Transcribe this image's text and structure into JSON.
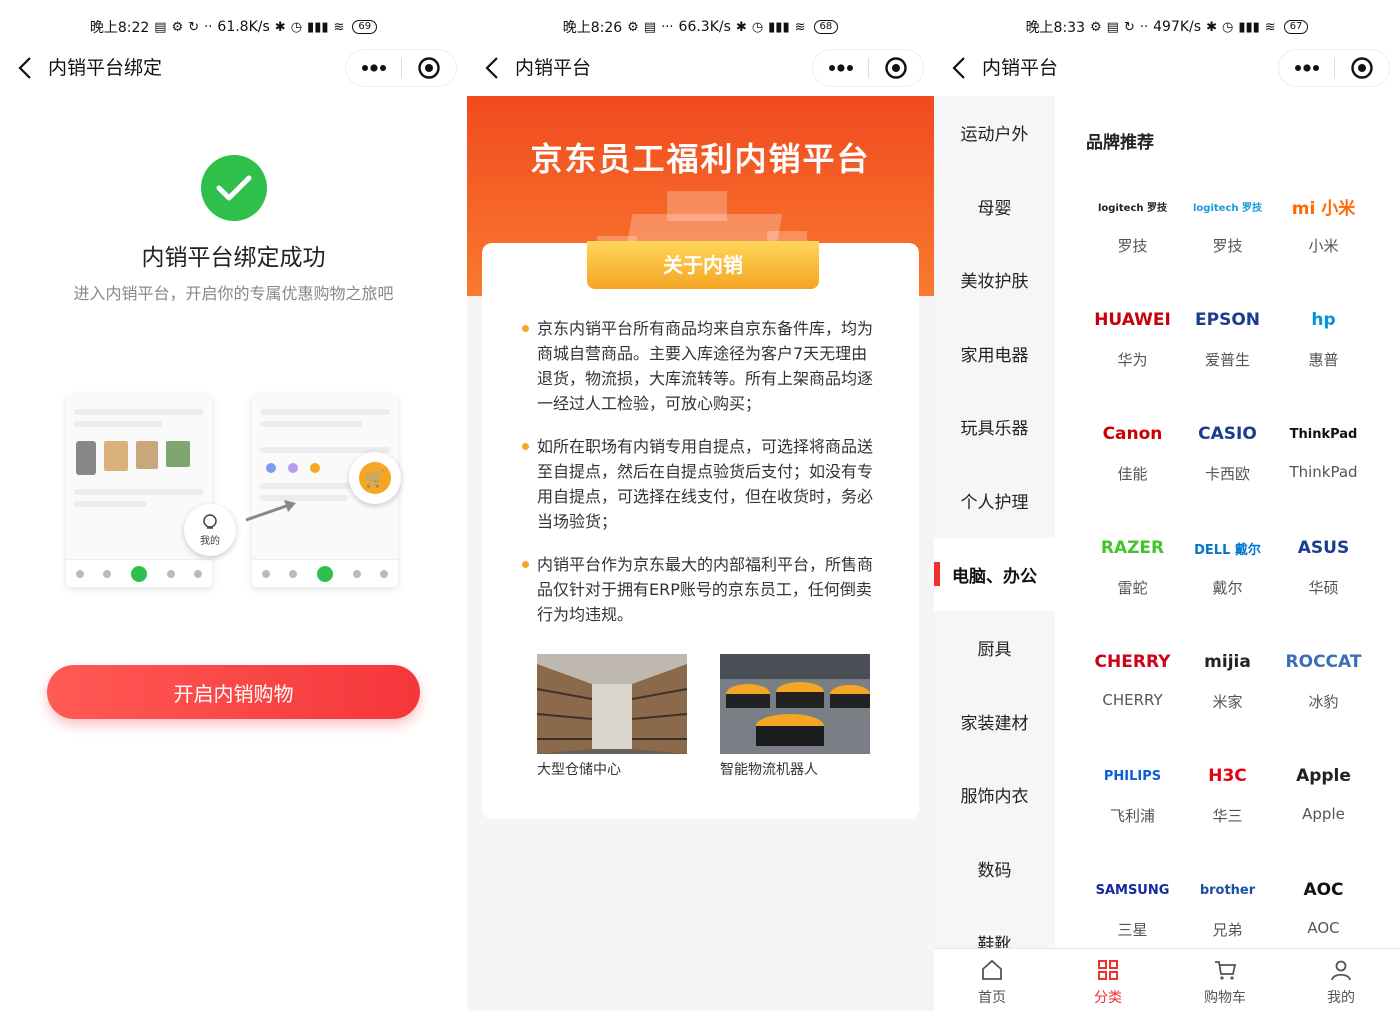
{
  "panel1": {
    "status": {
      "time": "晚上8:22",
      "speed": "61.8K/s",
      "battery": "69"
    },
    "nav_title": "内销平台绑定",
    "success_title": "内销平台绑定成功",
    "success_sub": "进入内销平台，开启你的专属优惠购物之旅吧",
    "bubble_label": "我的",
    "start_button": "开启内销购物",
    "colors": {
      "accent": "#f5363a",
      "success": "#2ec04a"
    }
  },
  "panel2": {
    "status": {
      "time": "晚上8:26",
      "speed": "66.3K/s",
      "battery": "68"
    },
    "nav_title": "内销平台",
    "banner_title": "京东员工福利内销平台",
    "card_tab": "关于内销",
    "paragraphs": [
      "京东内销平台所有商品均来自京东备件库，均为商城自营商品。主要入库途径为客户7天无理由退货，物流损，大库流转等。所有上架商品均逐一经过人工检验，可放心购买；",
      "如所在职场有内销专用自提点，可选择将商品送至自提点，然后在自提点验货后支付；如没有专用自提点，可选择在线支付，但在收货时，务必当场验货；",
      "内销平台作为京东最大的内部福利平台，所售商品仅针对于拥有ERP账号的京东员工，任何倒卖行为均违规。"
    ],
    "photos": [
      {
        "caption": "大型仓储中心"
      },
      {
        "caption": "智能物流机器人"
      }
    ],
    "colors": {
      "banner": "#f14a1f",
      "tab": "#f5a623"
    }
  },
  "panel3": {
    "status": {
      "time": "晚上8:33",
      "speed": "497K/s",
      "battery": "67"
    },
    "nav_title": "内销平台",
    "categories": [
      "运动户外",
      "母婴",
      "美妆护肤",
      "家用电器",
      "玩具乐器",
      "个人护理",
      "电脑、办公",
      "厨具",
      "家装建材",
      "服饰内衣",
      "数码",
      "鞋靴"
    ],
    "active_category": "电脑、办公",
    "brand_heading": "品牌推荐",
    "brands": [
      {
        "logo": "logitech 罗技",
        "name": "罗技",
        "color": "#222"
      },
      {
        "logo": "logitech 罗技",
        "name": "罗技",
        "color": "#1a9ad6"
      },
      {
        "logo": "mi 小米",
        "name": "小米",
        "color": "#ff6900"
      },
      {
        "logo": "HUAWEI",
        "name": "华为",
        "color": "#c7000b"
      },
      {
        "logo": "EPSON",
        "name": "爱普生",
        "color": "#1d3c8f"
      },
      {
        "logo": "hp",
        "name": "惠普",
        "color": "#0096d6"
      },
      {
        "logo": "Canon",
        "name": "佳能",
        "color": "#cc0000"
      },
      {
        "logo": "CASIO",
        "name": "卡西欧",
        "color": "#1d3c8f"
      },
      {
        "logo": "ThinkPad",
        "name": "ThinkPad",
        "color": "#111"
      },
      {
        "logo": "RAZER",
        "name": "雷蛇",
        "color": "#44c42c"
      },
      {
        "logo": "DELL 戴尔",
        "name": "戴尔",
        "color": "#0076ce"
      },
      {
        "logo": "ASUS",
        "name": "华硕",
        "color": "#1a3d8f"
      },
      {
        "logo": "CHERRY",
        "name": "CHERRY",
        "color": "#d0021b"
      },
      {
        "logo": "mijia",
        "name": "米家",
        "color": "#222"
      },
      {
        "logo": "ROCCAT",
        "name": "冰豹",
        "color": "#3a6fb5"
      },
      {
        "logo": "PHILIPS",
        "name": "飞利浦",
        "color": "#0b5ed7"
      },
      {
        "logo": "H3C",
        "name": "华三",
        "color": "#e60012"
      },
      {
        "logo": "Apple",
        "name": "Apple",
        "color": "#222"
      },
      {
        "logo": "SAMSUNG",
        "name": "三星",
        "color": "#1428a0"
      },
      {
        "logo": "brother",
        "name": "兄弟",
        "color": "#1d4fa0"
      },
      {
        "logo": "AOC",
        "name": "AOC",
        "color": "#111"
      }
    ],
    "tabs": [
      {
        "label": "首页",
        "icon": "home-icon"
      },
      {
        "label": "分类",
        "icon": "category-icon"
      },
      {
        "label": "购物车",
        "icon": "cart-icon"
      },
      {
        "label": "我的",
        "icon": "user-icon"
      }
    ],
    "active_tab": "分类",
    "colors": {
      "accent": "#f0302e"
    }
  }
}
